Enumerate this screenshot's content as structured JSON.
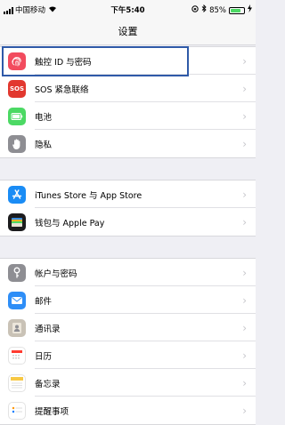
{
  "status_bar": {
    "carrier": "中国移动",
    "time": "下午5:40",
    "battery": "85%"
  },
  "nav": {
    "title": "设置"
  },
  "groups": [
    {
      "items": [
        {
          "label": "触控 ID 与密码",
          "icon": "fingerprint-icon",
          "color": "#f24b5e"
        },
        {
          "label": "SOS 紧急联络",
          "icon": "sos-icon",
          "color": "#e2382f",
          "icon_text": "SOS"
        },
        {
          "label": "电池",
          "icon": "battery-icon",
          "color": "#4cd964"
        },
        {
          "label": "隐私",
          "icon": "hand-icon",
          "color": "#8e8e93"
        }
      ]
    },
    {
      "items": [
        {
          "label": "iTunes Store 与 App Store",
          "icon": "app-store-icon",
          "color": "#1a8cf5"
        },
        {
          "label": "钱包与 Apple Pay",
          "icon": "wallet-icon",
          "color": "#1c1c1e"
        }
      ]
    },
    {
      "items": [
        {
          "label": "帐户与密码",
          "icon": "key-icon",
          "color": "#8e8e93"
        },
        {
          "label": "邮件",
          "icon": "mail-icon",
          "color": "#2e8ef7"
        },
        {
          "label": "通讯录",
          "icon": "contacts-icon",
          "color": "#b0a69a"
        },
        {
          "label": "日历",
          "icon": "calendar-icon",
          "color": "#ffffff"
        },
        {
          "label": "备忘录",
          "icon": "notes-icon",
          "color": "#ffffff"
        },
        {
          "label": "提醒事项",
          "icon": "reminders-icon",
          "color": "#ffffff"
        }
      ]
    }
  ],
  "chevron": "›"
}
